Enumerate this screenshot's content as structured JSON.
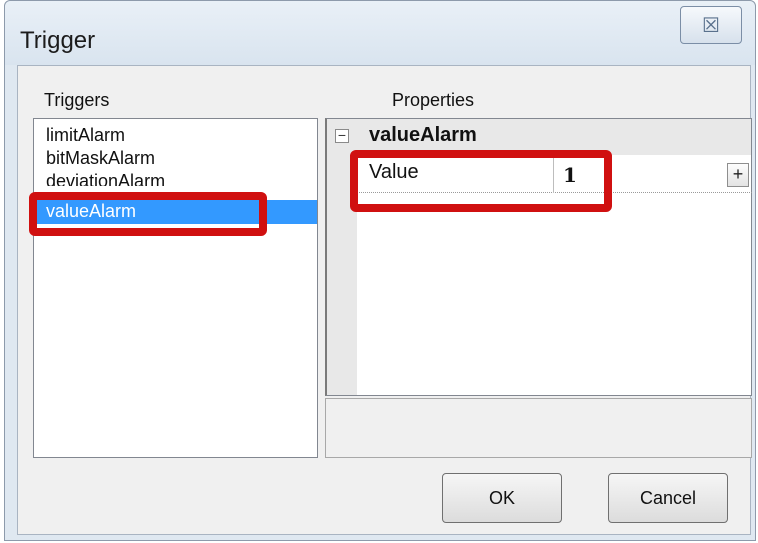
{
  "window": {
    "title": "Trigger",
    "close_glyph": "☒"
  },
  "triggers": {
    "label": "Triggers",
    "items": [
      {
        "label": "limitAlarm",
        "selected": false
      },
      {
        "label": "bitMaskAlarm",
        "selected": false
      },
      {
        "label": "deviationAlarm",
        "selected": false
      },
      {
        "label": "valueAlarm",
        "selected": true
      }
    ]
  },
  "properties": {
    "label": "Properties",
    "category": {
      "expander": "−",
      "title": "valueAlarm"
    },
    "rows": [
      {
        "name": "Value",
        "value": "1",
        "button": "+"
      }
    ]
  },
  "buttons": {
    "ok": "OK",
    "cancel": "Cancel"
  },
  "colors": {
    "selection": "#3399ff",
    "highlight": "#d01010"
  },
  "icons": {
    "close": "close-icon",
    "expander": "collapse-icon",
    "plus": "plus-icon"
  }
}
